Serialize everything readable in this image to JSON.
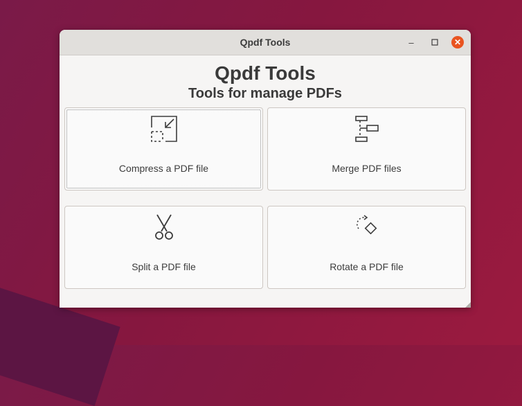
{
  "window": {
    "title": "Qpdf Tools",
    "controls": {
      "minimize": "–",
      "maximize": "☐",
      "close": "✕"
    }
  },
  "header": {
    "title": "Qpdf Tools",
    "subtitle": "Tools for manage PDFs"
  },
  "tools": [
    {
      "label": "Compress a PDF file",
      "icon": "compress-icon"
    },
    {
      "label": "Merge PDF files",
      "icon": "merge-icon"
    },
    {
      "label": "Split a PDF file",
      "icon": "scissors-icon"
    },
    {
      "label": "Rotate a PDF file",
      "icon": "rotate-icon"
    }
  ],
  "colors": {
    "close_button": "#e95420",
    "window_bg": "#f6f5f4",
    "titlebar_bg": "#e1dfdc"
  }
}
